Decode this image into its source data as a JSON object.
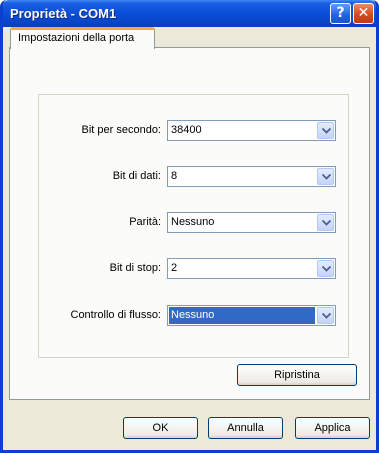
{
  "window": {
    "title": "Proprietà - COM1"
  },
  "tabs": [
    {
      "label": "Impostazioni della porta"
    }
  ],
  "settings": [
    {
      "label": "Bit per secondo:",
      "value": "38400"
    },
    {
      "label": "Bit di dati:",
      "value": "8"
    },
    {
      "label": "Parità:",
      "value": "Nessuno"
    },
    {
      "label": "Bit di stop:",
      "value": "2"
    },
    {
      "label": "Controllo di flusso:",
      "value": "Nessuno"
    }
  ],
  "buttons": {
    "restore": "Ripristina",
    "ok": "OK",
    "cancel": "Annulla",
    "apply": "Applica",
    "help": "?",
    "close": "✕"
  },
  "colors": {
    "titlebar": "#0a4fd8",
    "selection": "#316ac5",
    "tab_highlight": "#f7a83a"
  },
  "icons": [
    "help-icon",
    "close-icon",
    "chevron-down-icon"
  ]
}
